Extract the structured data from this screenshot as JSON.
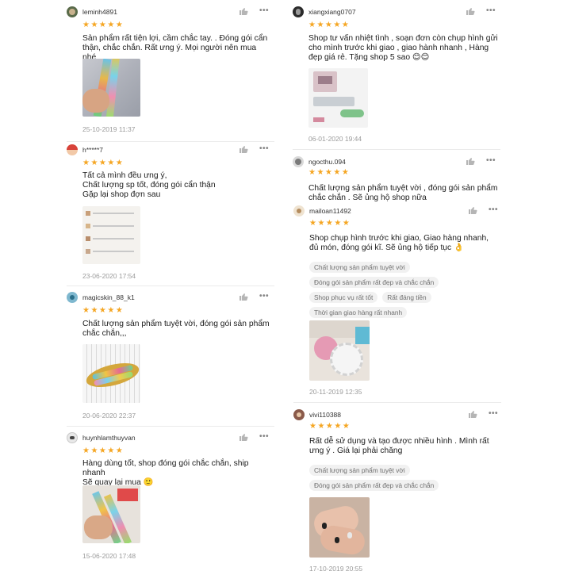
{
  "reviews": [
    {
      "username": "leminh4891",
      "comment": "Sản phẩm rất tiện lợi, cầm chắc tay. . Đóng gói cẩn thận, chắc chắn. Rất ưng ý. Mọi người nên mua nhé",
      "date": "25-10-2019 11:37"
    },
    {
      "username": "h*****7",
      "comment": "Tất cả mình đều ưng ý,\nChất lượng sp tốt,  đóng gói cẩn thận\nGặp lại shop đợn sau",
      "date": "23-06-2020 17:54"
    },
    {
      "username": "magicskin_88_k1",
      "comment": "Chất lượng sản phẩm tuyệt vời, đóng gói sản phẩm chắc chắn,,,",
      "date": "20-06-2020 22:37"
    },
    {
      "username": "huynhlamthuyvan",
      "comment": "Hàng dùng tốt, shop đóng gói chắc chắn, ship nhanh\nSẽ quay lại mua 🙂",
      "date": "15-06-2020 17:48"
    },
    {
      "username": "xiangxiang0707",
      "comment": "Shop tư vấn nhiệt tình , soạn đơn còn chụp hình gửi cho mình trước khi giao , giao hành nhanh , Hàng đẹp giá rẻ. Tặng shop 5 sao 😊😊",
      "date": "06-01-2020 19:44"
    },
    {
      "username": "ngocthu.094",
      "comment": "Chất lượng sản phẩm tuyệt vời , đóng gói sản phẩm chắc chắn . Sẽ ủng hộ shop nữa",
      "date": ""
    },
    {
      "username": "mailoan11492",
      "comment": "Shop chụp hình trước khi giao, Giao hàng nhanh, đủ món, đóng gói kĩ. Sẽ ủng hộ tiếp tục 👌",
      "tags": [
        "Chất lượng sản phẩm tuyệt vời",
        "Đóng gói sản phẩm rất đẹp và chắc chắn",
        "Shop phục vụ rất tốt",
        "Rất đáng tiền",
        "Thời gian giao hàng rất nhanh"
      ],
      "date": "20-11-2019 12:35"
    },
    {
      "username": "vivi110388",
      "comment": "Rất dễ sử dụng và tạo được nhiều hình . Mình rất ưng ý . Giá lại phải chăng",
      "tags": [
        "Chất lượng sản phẩm tuyệt vời",
        "Đóng gói sản phẩm rất đẹp và chắc chắn"
      ],
      "date": "17-10-2019 20:55"
    }
  ],
  "rating_stars": "★★★★★",
  "more_glyph": "•••",
  "colors": {
    "star": "#f5a623",
    "tag_bg": "#f1f1f1",
    "date": "#9b9b9b"
  },
  "icons": {
    "like": "thumbs-up-icon",
    "more": "more-dots-icon"
  }
}
